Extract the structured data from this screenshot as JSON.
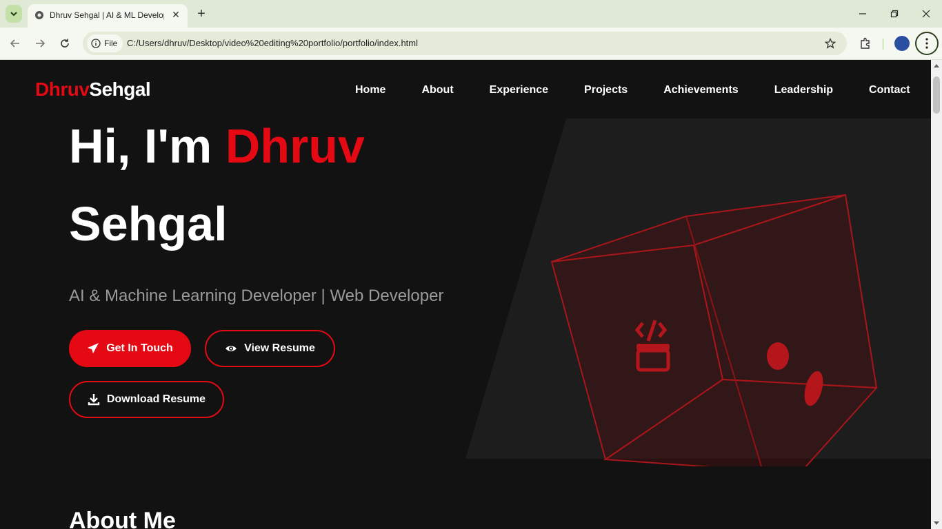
{
  "browser": {
    "tab_title": "Dhruv Sehgal | AI & ML Developer",
    "site_chip": "File",
    "url": "C:/Users/dhruv/Desktop/video%20editing%20portfolio/portfolio/index.html"
  },
  "page": {
    "logo_first": "Dhruv",
    "logo_last": "Sehgal",
    "nav": [
      "Home",
      "About",
      "Experience",
      "Projects",
      "Achievements",
      "Leadership",
      "Contact"
    ],
    "hero": {
      "greeting": "Hi, I'm ",
      "first_name": "Dhruv",
      "last_name": "Sehgal",
      "subtitle": "AI & Machine Learning Developer | Web Developer",
      "buttons": {
        "get_in_touch": "Get In Touch",
        "view_resume": "View Resume",
        "download_resume": "Download Resume"
      }
    },
    "about_heading": "About Me"
  },
  "colors": {
    "accent": "#e50914",
    "background": "#121212",
    "panel": "#1d1d1d"
  }
}
